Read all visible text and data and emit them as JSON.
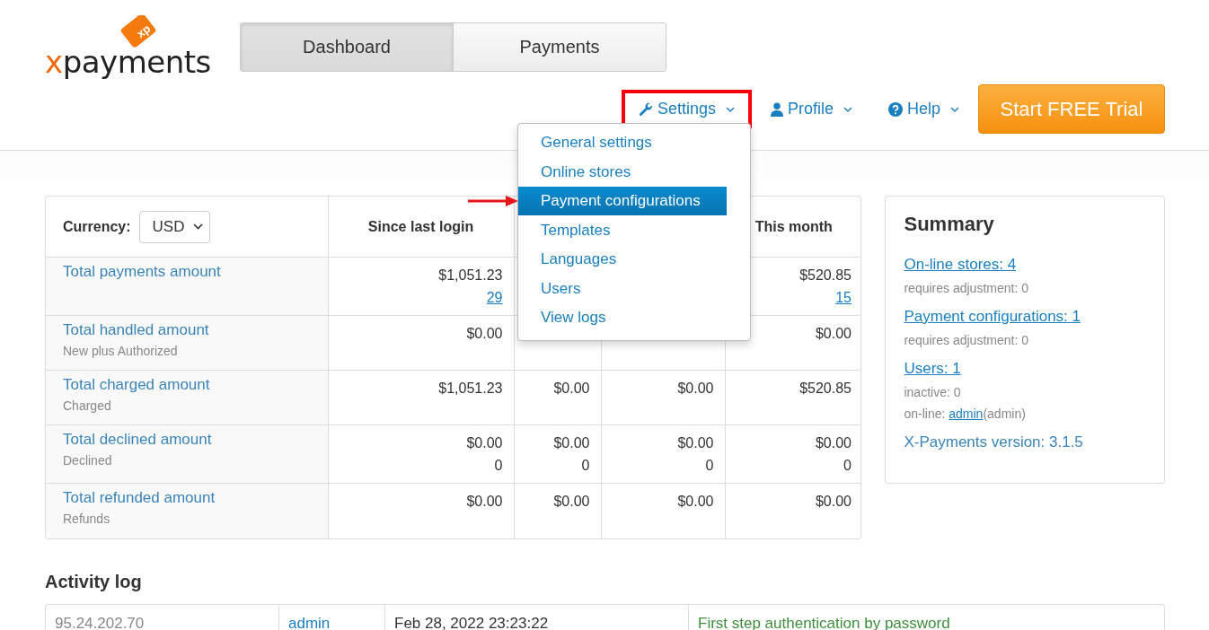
{
  "logo": {
    "accent": "x",
    "text": "payments",
    "badge": "xp"
  },
  "tabs": [
    {
      "label": "Dashboard",
      "selected": true
    },
    {
      "label": "Payments",
      "selected": false
    }
  ],
  "nav": [
    {
      "label": "Settings",
      "annotated": true,
      "menu": [
        {
          "label": "General settings",
          "selected": false,
          "pointed": false
        },
        {
          "label": "Online stores",
          "selected": false,
          "pointed": false
        },
        {
          "label": "Payment configurations",
          "selected": true,
          "pointed": true
        },
        {
          "label": "Templates",
          "selected": false,
          "pointed": false
        },
        {
          "label": "Languages",
          "selected": false,
          "pointed": false
        },
        {
          "label": "Users",
          "selected": false,
          "pointed": false
        },
        {
          "label": "View logs",
          "selected": false,
          "pointed": false
        }
      ]
    },
    {
      "label": "Profile",
      "annotated": false
    },
    {
      "label": "Help",
      "annotated": false
    }
  ],
  "trial_button": "Start FREE Trial",
  "stats": {
    "currency_label": "Currency:",
    "currency": "USD",
    "columns": {
      "since_last_login": "Since last login",
      "this_month": "This month"
    },
    "rows": [
      {
        "label": "Total payments amount",
        "values": {
          "since_last_login": {
            "amount": "$1,051.23",
            "count": "29",
            "count_link": true
          },
          "this_month": {
            "amount": "$520.85",
            "count": "15",
            "count_link": true
          }
        }
      },
      {
        "label": "Total handled amount",
        "sub": "New plus Authorized",
        "values": {
          "since_last_login": {
            "amount": "$0.00"
          },
          "this_month": {
            "amount": "$0.00"
          }
        }
      },
      {
        "label": "Total charged amount",
        "sub": "Charged",
        "values": {
          "since_last_login": {
            "amount": "$1,051.23"
          },
          "column_2": {
            "amount": "$0.00"
          },
          "column_3": {
            "amount": "$0.00"
          },
          "this_month": {
            "amount": "$520.85"
          }
        }
      },
      {
        "label": "Total declined amount",
        "sub": "Declined",
        "values": {
          "since_last_login": {
            "amount": "$0.00",
            "count": "0",
            "count_link": false
          },
          "column_2": {
            "amount": "$0.00",
            "count": "0",
            "count_link": false
          },
          "column_3": {
            "amount": "$0.00",
            "count": "0",
            "count_link": false
          },
          "this_month": {
            "amount": "$0.00",
            "count": "0",
            "count_link": false
          }
        }
      },
      {
        "label": "Total refunded amount",
        "sub": "Refunds",
        "values": {
          "since_last_login": {
            "amount": "$0.00"
          },
          "column_2": {
            "amount": "$0.00"
          },
          "column_3": {
            "amount": "$0.00"
          },
          "this_month": {
            "amount": "$0.00"
          }
        }
      }
    ]
  },
  "summary": {
    "title": "Summary",
    "items": [
      {
        "link": "On-line stores: 4",
        "notes": [
          "requires adjustment: 0"
        ]
      },
      {
        "link": "Payment configurations: 1",
        "notes": [
          "requires adjustment: 0"
        ]
      },
      {
        "link": "Users: 1",
        "notes": [
          "inactive: 0"
        ],
        "online": {
          "prefix": "on-line: ",
          "user": "admin",
          "suffix": "(admin)"
        }
      }
    ],
    "version": "X-Payments version: 3.1.5"
  },
  "activity_log": {
    "title": "Activity log",
    "rows": [
      {
        "ip": "95.24.202.70",
        "user": "admin",
        "time": "Feb 28, 2022 23:23:22",
        "message": "First step authentication by password"
      }
    ]
  }
}
